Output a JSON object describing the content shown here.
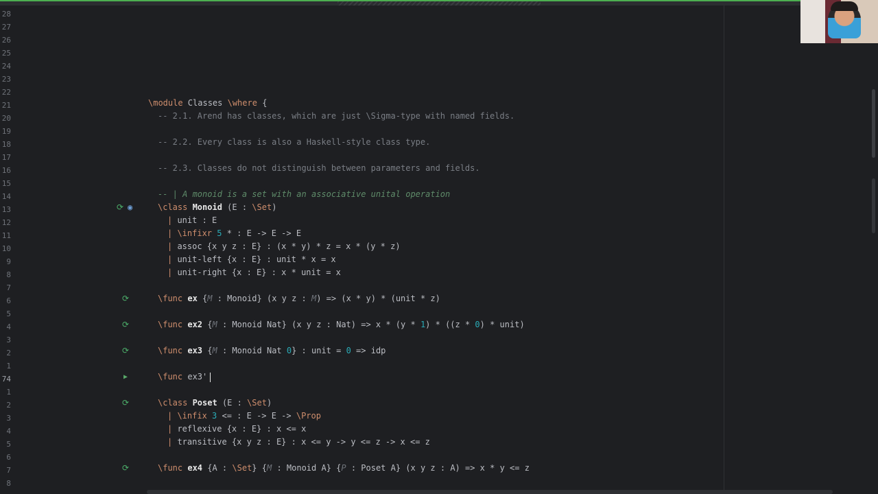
{
  "line_numbers": [
    "28",
    "27",
    "26",
    "25",
    "24",
    "23",
    "22",
    "21",
    "20",
    "19",
    "18",
    "17",
    "16",
    "15",
    "14",
    "13",
    "12",
    "11",
    "10",
    "9",
    "8",
    "7",
    "6",
    "5",
    "4",
    "3",
    "2",
    "1",
    "74",
    "1",
    "2",
    "3",
    "4",
    "5",
    "6",
    "7",
    "8"
  ],
  "current_line": "74",
  "code": {
    "l21": {
      "kw1": "\\module",
      "name": " Classes ",
      "kw2": "\\where",
      "rest": " {"
    },
    "l20": "-- 2.1. Arend has classes, which are just \\Sigma-type with named fields.",
    "l18": "-- 2.2. Every class is also a Haskell-style class type.",
    "l16": "-- 2.3. Classes do not distinguish between parameters and fields.",
    "l14": "-- | A monoid is a set with an associative unital operation",
    "l13": {
      "kw": "\\class",
      "name": " Monoid",
      "params": " (E : ",
      "set": "\\Set",
      ")": ")"
    },
    "l12": {
      "bar": "| ",
      "rest": "unit : E"
    },
    "l11": {
      "bar": "| ",
      "kw": "\\infixr",
      "num": " 5",
      "rest": " * : E -> E -> E"
    },
    "l10": {
      "bar": "| ",
      "rest": "assoc {x y z : E} : (x * y) * z = x * (y * z)"
    },
    "l9": {
      "bar": "| ",
      "rest": "unit-left {x : E} : unit * x = x"
    },
    "l8": {
      "bar": "| ",
      "rest": "unit-right {x : E} : x * unit = x"
    },
    "l6": {
      "kw": "\\func",
      "name": " ex",
      "a": " {",
      "m": "M",
      "b": " : Monoid} (x y z : ",
      "m2": "M",
      "c": ") => (x * y) * (unit * z)"
    },
    "l4": {
      "kw": "\\func",
      "name": " ex2",
      "a": " {",
      "m": "M",
      "b": " : Monoid Nat} (x y z : Nat) => x * (y * ",
      "n1": "1",
      "c": ") * ((z * ",
      "n0": "0",
      "d": ") * unit)"
    },
    "l2": {
      "kw": "\\func",
      "name": " ex3",
      "a": " {",
      "m": "M",
      "b": " : Monoid Nat ",
      "n0": "0",
      "c": "} : unit = ",
      "n0b": "0",
      "d": " => idp"
    },
    "l74": {
      "kw": "\\func",
      "name": " ex3'"
    },
    "p3": {
      "kw": "\\class",
      "name": " Poset",
      "params": " (E : ",
      "set": "\\Set",
      "close": ")"
    },
    "p4": {
      "bar": "| ",
      "kw": "\\infix",
      "num": " 3",
      "rest": " <= : E -> E -> ",
      "prop": "\\Prop"
    },
    "p5": {
      "bar": "| ",
      "rest": "reflexive {x : E} : x <= x"
    },
    "p6": {
      "bar": "| ",
      "rest": "transitive {x y z : E} : x <= y -> y <= z -> x <= z"
    },
    "p8": {
      "kw": "\\func",
      "name": " ex4",
      "a": " {A : ",
      "set": "\\Set",
      "b": "} {",
      "m": "M",
      "c": " : Monoid A} {",
      "p": "P",
      "d": " : Poset A} (x y z : A) => x * y <= z"
    }
  },
  "colors": {
    "background": "#1e1f22",
    "keyword": "#cf8e6d",
    "comment": "#7a7e85",
    "doc_comment": "#5f8c6a",
    "number": "#2aacb8",
    "gutter_ok": "#4caf6a"
  },
  "icons": [
    "check-run-icon",
    "implemented-icon",
    "run-arrow-icon"
  ]
}
